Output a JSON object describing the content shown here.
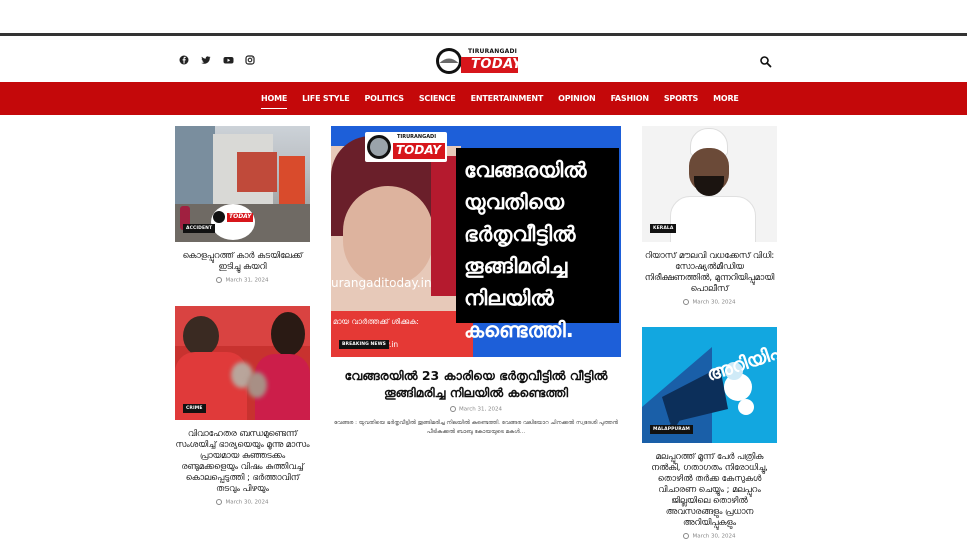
{
  "header": {
    "logo_top": "TIRURANGADI",
    "logo_main": "TODAY",
    "social_icons": [
      "facebook-icon",
      "twitter-icon",
      "youtube-icon",
      "instagram-icon"
    ]
  },
  "nav": {
    "items": [
      "HOME",
      "LIFE STYLE",
      "POLITICS",
      "SCIENCE",
      "ENTERTAINMENT",
      "OPINION",
      "FASHION",
      "SPORTS",
      "MORE"
    ],
    "active": "HOME"
  },
  "colors": {
    "brand_red": "#c4080a",
    "banner_blue": "#1d5fd9"
  },
  "left_col": [
    {
      "tag": "ACCIDENT",
      "title": "കൊളപ്പുറത്ത് കാർ കടയിലേക്ക് ഇടിച്ചു കയറി",
      "date": "March 31, 2024",
      "image_watermark": "TODAY"
    },
    {
      "tag": "CRIME",
      "title": "വിവാഹേതര ബന്ധമുണ്ടെന്ന് സംശയിച്ച് ഭാര്യയെയും മൂന്നു മാസം പ്രായമായ കുഞ്ഞടക്കം രണ്ടുമക്കളെയും വിഷം കുത്തിവച്ച് കൊലപ്പെടുത്തി ; ഭർത്താവിന് തടവും പിഴയും",
      "date": "March 30, 2024"
    }
  ],
  "featured": {
    "tag": "BREAKING NEWS",
    "image_headline": "വേങ്ങരയിൽ യുവതിയെ ഭർതൃവീട്ടിൽ തൂങ്ങിമരിച്ച നിലയിൽ കണ്ടെത്തി.",
    "image_site": "urangaditoday.in",
    "image_strip": "മായ വാർത്തക്ക് ശിക്കുക:",
    "image_strip2": "ay.in",
    "logo_top": "TIRURANGADI",
    "logo_main": "TODAY",
    "title": "വേങ്ങരയിൽ 23 കാരിയെ ഭർതൃവീട്ടിൽ വീട്ടിൽ തൂങ്ങിമരിച്ച നിലയിൽ കണ്ടെത്തി",
    "date": "March 31, 2024",
    "excerpt": "വേങ്ങര : യുവതിയെ ഭർതൃവീട്ടിൽ തൂങ്ങിമരിച്ച നിലയിൽ കണ്ടെത്തി. വേങ്ങര വലിയോറ ചിനക്കൽ സ്വദേശി പുത്തൻ പീടികക്കൽ ബാബു കോയയുടെ മകൾ..."
  },
  "right_col": [
    {
      "tag": "KERALA",
      "title": "റിയാസ് മൗലവി വധക്കേസ് വിധി: സോഷ്യൽമീഡിയ നിരീക്ഷണത്തിൽ, മുന്നറിയിപ്പുമായി പൊലീസ്",
      "date": "March 30, 2024"
    },
    {
      "tag": "MALAPPURAM",
      "title": "മലപ്പുറത്ത് മൂന്ന് പേർ പത്രിക നൽകി, ഗതാഗതം നിരോധിച്ചു, തൊഴിൽ തർക്ക കേസുകൾ വിചാരണ ചെയ്യും ; മലപ്പുറം ജില്ലയിലെ തൊഴിൽ അവസരങ്ങളും പ്രധാന അറിയിപ്പുകളും",
      "date": "March 30, 2024",
      "image_text": "അറിയിപ്പ്"
    }
  ]
}
